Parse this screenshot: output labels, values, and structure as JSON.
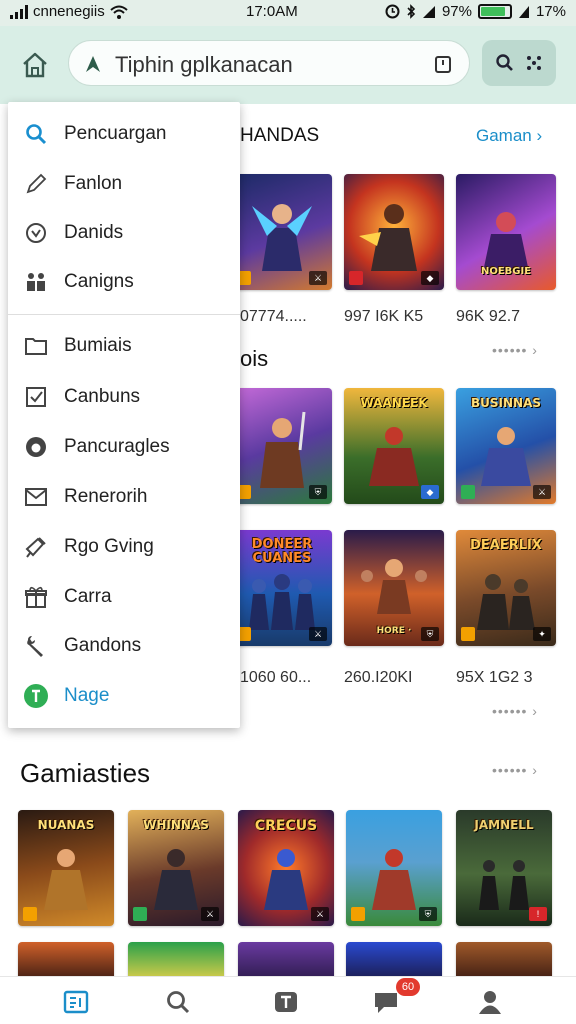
{
  "status_bar": {
    "carrier": "cnnenegiis",
    "time": "17:0AM",
    "battery_text": "97%",
    "extra_percent": "17%"
  },
  "browser": {
    "url": "Tiphin gplkanacan"
  },
  "menu": {
    "items": [
      {
        "label": "Pencuargan",
        "icon": "search-icon"
      },
      {
        "label": "Fanlon",
        "icon": "pencil-icon"
      },
      {
        "label": "Danids",
        "icon": "badge-icon"
      },
      {
        "label": "Canigns",
        "icon": "people-icon"
      },
      {
        "label": "Bumiais",
        "icon": "folder-icon"
      },
      {
        "label": "Canbuns",
        "icon": "checkbox-icon"
      },
      {
        "label": "Pancuragles",
        "icon": "circle-icon"
      },
      {
        "label": "Renerorih",
        "icon": "mail-icon"
      },
      {
        "label": "Rgo Gving",
        "icon": "megaphone-icon"
      },
      {
        "label": "Carra",
        "icon": "gift-icon"
      },
      {
        "label": "Gandons",
        "icon": "wrench-icon"
      },
      {
        "label": "Nage",
        "icon": "user-circle-icon"
      }
    ]
  },
  "sections": {
    "first": {
      "title": "HANDAS",
      "more": "Gaman"
    },
    "second": {
      "title": "ois"
    },
    "third": {
      "title": "Gamiasties"
    }
  },
  "captions": {
    "row1": [
      "07774.....",
      "997 I6K K5",
      "96K 92.7"
    ],
    "row3": [
      "1060 60...",
      "260.I20KI",
      "95X 1G2 3"
    ]
  },
  "thumb_titles": {
    "r1": [
      "",
      "",
      "NOEBGIE"
    ],
    "r2": [
      "",
      "WAANEEK",
      "BUSINNAS"
    ],
    "r3": [
      "DONEER CUANES",
      "",
      "DEAERLIX"
    ],
    "r4": [
      "NUANAS",
      "WHINNAS",
      "CRECUS",
      "",
      "JAMNELL"
    ]
  },
  "bottom_nav": {
    "badge": "60"
  },
  "colors": {
    "appbar": "#d9eee6",
    "accent": "#1b8ec9",
    "badge": "#e23a2e"
  }
}
